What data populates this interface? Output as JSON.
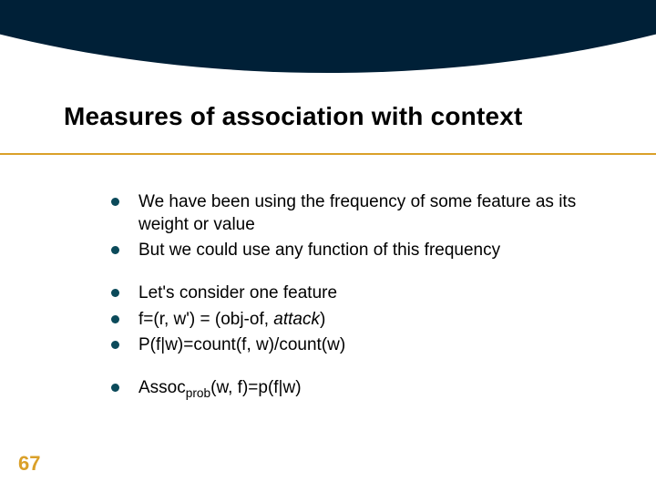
{
  "title": "Measures of association with context",
  "bullets": {
    "b1": "We have been using the frequency of some feature as its weight or value",
    "b2": "But we could use any function of this frequency",
    "b3": "Let's consider one feature",
    "b4_pre": "f=(r, w') = (obj-of, ",
    "b4_ital": "attack",
    "b4_post": ")",
    "b5": "P(f|w)=count(f, w)/count(w)",
    "b6_pre": "Assoc",
    "b6_sub": "prob",
    "b6_post": "(w, f)=p(f|w)"
  },
  "page_number": "67"
}
